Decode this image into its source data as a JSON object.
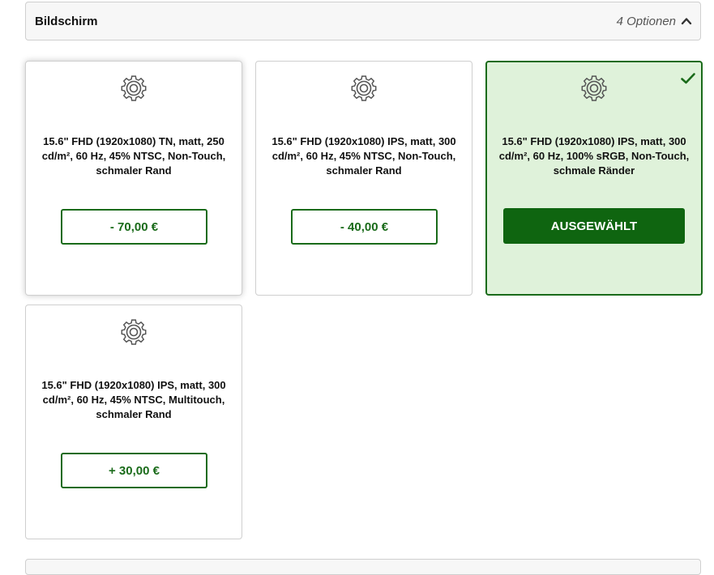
{
  "section": {
    "title": "Bildschirm",
    "options_count": "4 Optionen",
    "toggle_icon": "chevron-up-icon"
  },
  "options": [
    {
      "icon": "gear-icon",
      "description": "15.6\" FHD (1920x1080) TN, matt, 250 cd/m², 60 Hz, 45% NTSC, Non-Touch, schmaler Rand",
      "price_label": "- 70,00 €",
      "selected": false
    },
    {
      "icon": "gear-icon",
      "description": "15.6\" FHD (1920x1080) IPS, matt, 300 cd/m², 60 Hz, 45% NTSC, Non-Touch, schmaler Rand",
      "price_label": "- 40,00 €",
      "selected": false
    },
    {
      "icon": "gear-icon",
      "description": "15.6\" FHD (1920x1080) IPS, matt, 300 cd/m², 60 Hz, 100% sRGB, Non-Touch, schmale Ränder",
      "price_label": "AUSGEWÄHLT",
      "selected": true,
      "status_icon": "checkmark-icon"
    },
    {
      "icon": "gear-icon",
      "description": "15.6\" FHD (1920x1080) IPS, matt, 300 cd/m², 60 Hz, 45% NTSC, Multitouch, schmaler Rand",
      "price_label": "+ 30,00 €",
      "selected": false
    }
  ],
  "colors": {
    "accent_green": "#1a6b1a",
    "selected_bg": "#dff2da",
    "selected_button": "#0f6510"
  }
}
